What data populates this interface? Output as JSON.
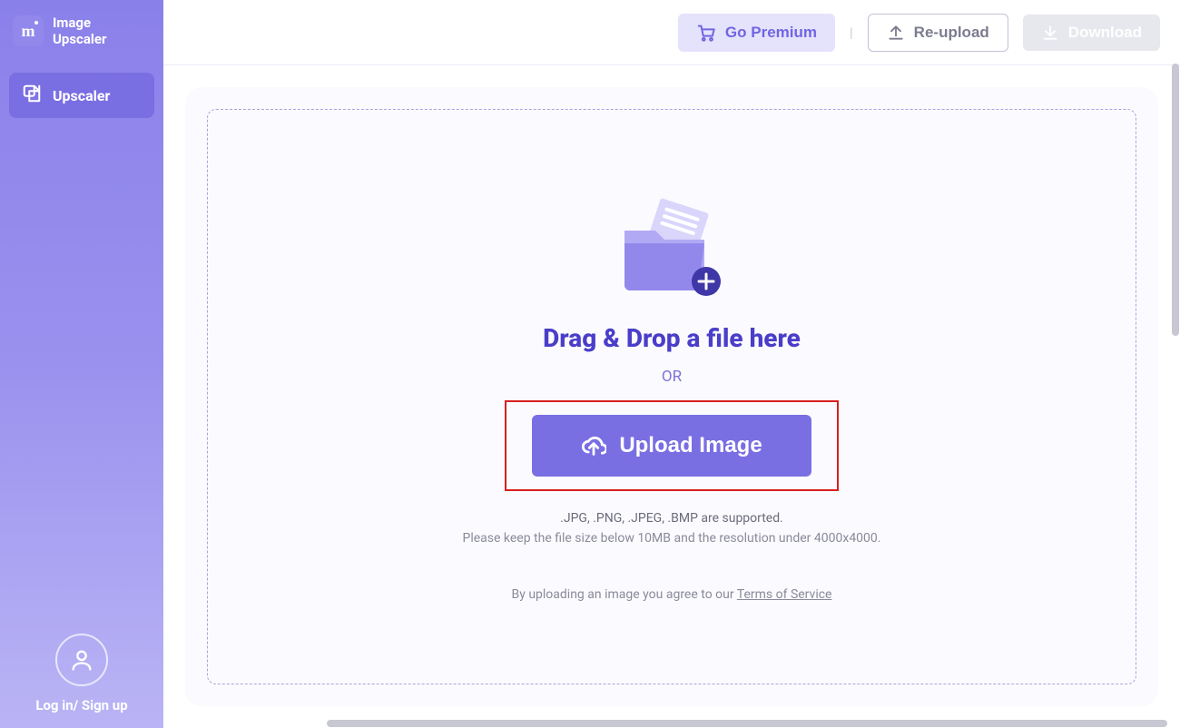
{
  "brand": {
    "line1": "Image",
    "line2": "Upscaler"
  },
  "sidebar": {
    "items": [
      {
        "label": "Upscaler"
      }
    ],
    "login": "Log in/ Sign up"
  },
  "topbar": {
    "premium": "Go Premium",
    "reupload": "Re-upload",
    "download": "Download",
    "separator": "|"
  },
  "drop": {
    "title": "Drag & Drop a file here",
    "or": "OR",
    "upload": "Upload Image",
    "hint1": ".JPG, .PNG, .JPEG, .BMP are supported.",
    "hint2": "Please keep the file size below 10MB and the resolution under 4000x4000.",
    "tos_prefix": "By uploading an image you agree to our ",
    "tos_link": "Terms of Service"
  }
}
